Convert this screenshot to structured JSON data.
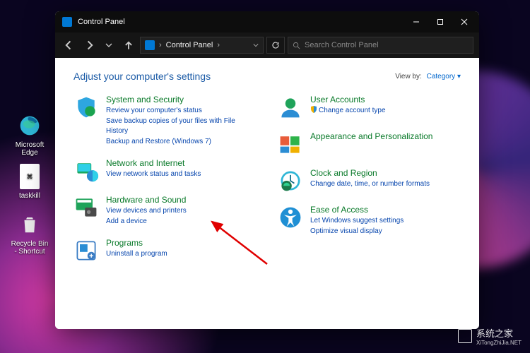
{
  "window": {
    "title": "Control Panel"
  },
  "nav": {
    "breadcrumb": "Control Panel",
    "search_placeholder": "Search Control Panel"
  },
  "content": {
    "heading": "Adjust your computer's settings",
    "viewby_label": "View by:",
    "viewby_value": "Category"
  },
  "left": [
    {
      "title": "System and Security",
      "links": [
        "Review your computer's status",
        "Save backup copies of your files with File History",
        "Backup and Restore (Windows 7)"
      ]
    },
    {
      "title": "Network and Internet",
      "links": [
        "View network status and tasks"
      ]
    },
    {
      "title": "Hardware and Sound",
      "links": [
        "View devices and printers",
        "Add a device"
      ]
    },
    {
      "title": "Programs",
      "links": [
        "Uninstall a program"
      ]
    }
  ],
  "right": [
    {
      "title": "User Accounts",
      "links": [
        "Change account type"
      ],
      "uac": [
        true
      ]
    },
    {
      "title": "Appearance and Personalization",
      "links": []
    },
    {
      "title": "Clock and Region",
      "links": [
        "Change date, time, or number formats"
      ]
    },
    {
      "title": "Ease of Access",
      "links": [
        "Let Windows suggest settings",
        "Optimize visual display"
      ]
    }
  ],
  "desktop": {
    "edge": "Microsoft Edge",
    "taskkill": "taskkill",
    "recycle": "Recycle Bin - Shortcut"
  },
  "watermark": {
    "cn": "系统之家",
    "en": "XiTongZhiJia.NET"
  }
}
